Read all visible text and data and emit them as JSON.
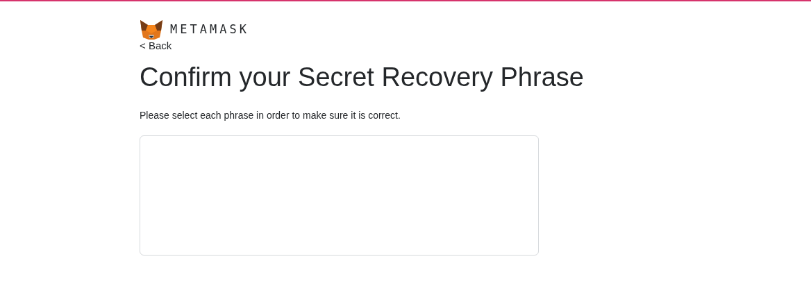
{
  "header": {
    "logo_text": "METAMASK"
  },
  "back_link": {
    "label": "< Back"
  },
  "title": "Confirm your Secret Recovery Phrase",
  "instructions": "Please select each phrase in order to make sure it is correct."
}
